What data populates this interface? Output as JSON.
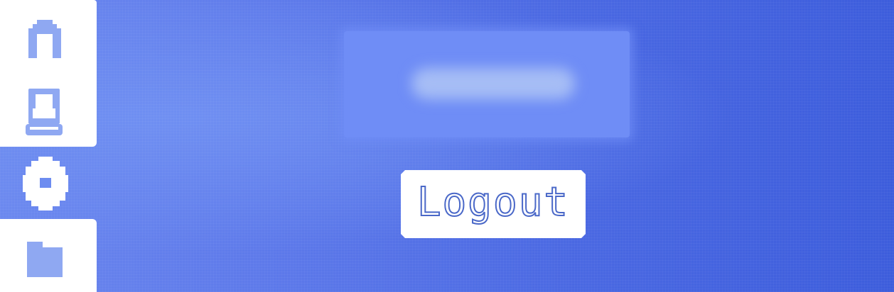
{
  "sidebar": {
    "items": [
      {
        "icon": "home-icon",
        "active": true
      },
      {
        "icon": "user-profile-icon",
        "active": true
      },
      {
        "icon": "settings-icon",
        "active": false
      },
      {
        "icon": "folder-icon",
        "active": true
      }
    ]
  },
  "title_panel": {
    "text": ""
  },
  "logout_button": {
    "label": "Logout"
  },
  "colors": {
    "background": "#5270e6",
    "sidebar_active": "#ffffff",
    "icon_on_white": "#8fa8f2",
    "icon_on_blue": "#ffffff",
    "button_text_outline": "#4a68c8"
  }
}
